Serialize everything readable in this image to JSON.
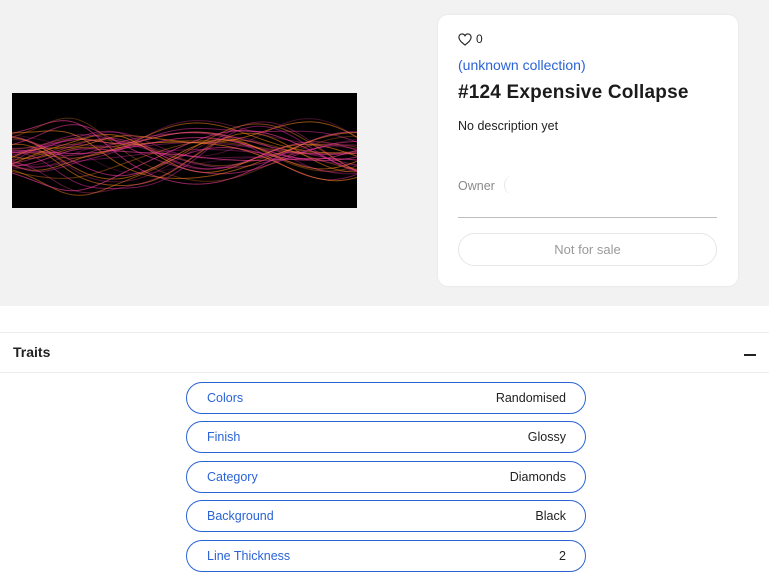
{
  "item": {
    "likes": "0",
    "collection": "(unknown collection)",
    "title": "#124 Expensive Collapse",
    "description": "No description yet",
    "owner_label": "Owner",
    "sale_status": "Not for sale"
  },
  "icons": {
    "like": "heart-outline-icon",
    "collapse": "minus-icon"
  },
  "colors": {
    "accent": "#2a63d6",
    "page_background": "#f2f2f2",
    "artwork_background": "#000000",
    "wave_pink": "#ff3fa4",
    "wave_orange": "#ff8a1e",
    "wave_magenta": "#c02a8a"
  },
  "traits": {
    "title": "Traits",
    "items": [
      {
        "name": "Colors",
        "value": "Randomised"
      },
      {
        "name": "Finish",
        "value": "Glossy"
      },
      {
        "name": "Category",
        "value": "Diamonds"
      },
      {
        "name": "Background",
        "value": "Black"
      },
      {
        "name": "Line Thickness",
        "value": "2"
      }
    ]
  }
}
